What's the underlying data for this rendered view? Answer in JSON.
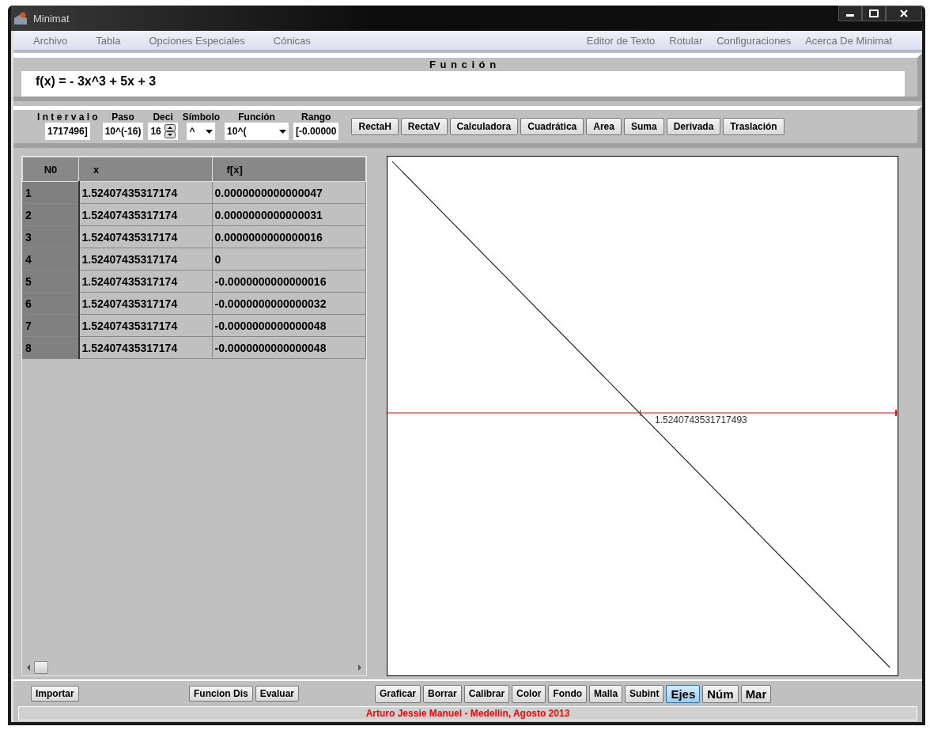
{
  "window": {
    "title": "Minimat"
  },
  "menu": {
    "left": [
      "Archivo",
      "Tabla",
      "Opciones Especiales",
      "Cónicas"
    ],
    "right": [
      "Editor de Texto",
      "Rotular",
      "Configuraciones",
      "Acerca De Minimat"
    ]
  },
  "function_panel": {
    "heading": "F u n c i ó n",
    "value": "f(x) = - 3x^3 + 5x + 3"
  },
  "controls": [
    {
      "label": "I n t e r v a l o",
      "kind": "text",
      "value": "1717496]"
    },
    {
      "label": "Paso",
      "kind": "text",
      "value": "10^(-16)"
    },
    {
      "label": "Deci",
      "kind": "spinner",
      "value": "16"
    },
    {
      "label": "Símbolo",
      "kind": "dropdown",
      "value": "^"
    },
    {
      "label": "Función",
      "kind": "dropdown",
      "value": "10^("
    },
    {
      "label": "Rango",
      "kind": "text",
      "value": "[-0.00000"
    }
  ],
  "tools": [
    "RectaH",
    "RectaV",
    "Calculadora",
    "Cuadrática",
    "Area",
    "Suma",
    "Derivada",
    "Traslación"
  ],
  "table": {
    "columns": [
      "N0",
      "x",
      "f[x]"
    ],
    "rows": [
      [
        "1",
        "1.52407435317174",
        "0.0000000000000047"
      ],
      [
        "2",
        "1.52407435317174",
        "0.0000000000000031"
      ],
      [
        "3",
        "1.52407435317174",
        "0.0000000000000016"
      ],
      [
        "4",
        "1.52407435317174",
        "0"
      ],
      [
        "5",
        "1.52407435317174",
        "-0.0000000000000016"
      ],
      [
        "6",
        "1.52407435317174",
        "-0.0000000000000032"
      ],
      [
        "7",
        "1.52407435317174",
        "-0.0000000000000048"
      ],
      [
        "8",
        "1.52407435317174",
        "-0.0000000000000048"
      ]
    ]
  },
  "plot": {
    "root_label": "1.5240743531717493"
  },
  "bottom_left": [
    "Importar"
  ],
  "bottom_middle": [
    "Funcion Dis",
    "Evaluar"
  ],
  "bottom_right": [
    {
      "label": "Graficar",
      "selected": false
    },
    {
      "label": "Borrar",
      "selected": false
    },
    {
      "label": "Calibrar",
      "selected": false
    },
    {
      "label": "Color",
      "selected": false
    },
    {
      "label": "Fondo",
      "selected": false
    },
    {
      "label": "Malla",
      "selected": false
    },
    {
      "label": "Subint",
      "selected": false
    },
    {
      "label": "Ejes",
      "selected": true
    },
    {
      "label": "Núm",
      "selected": false
    },
    {
      "label": "Mar",
      "selected": false
    }
  ],
  "status_bar": "Arturo Jessie Manuel - Medellin, Agosto 2013"
}
